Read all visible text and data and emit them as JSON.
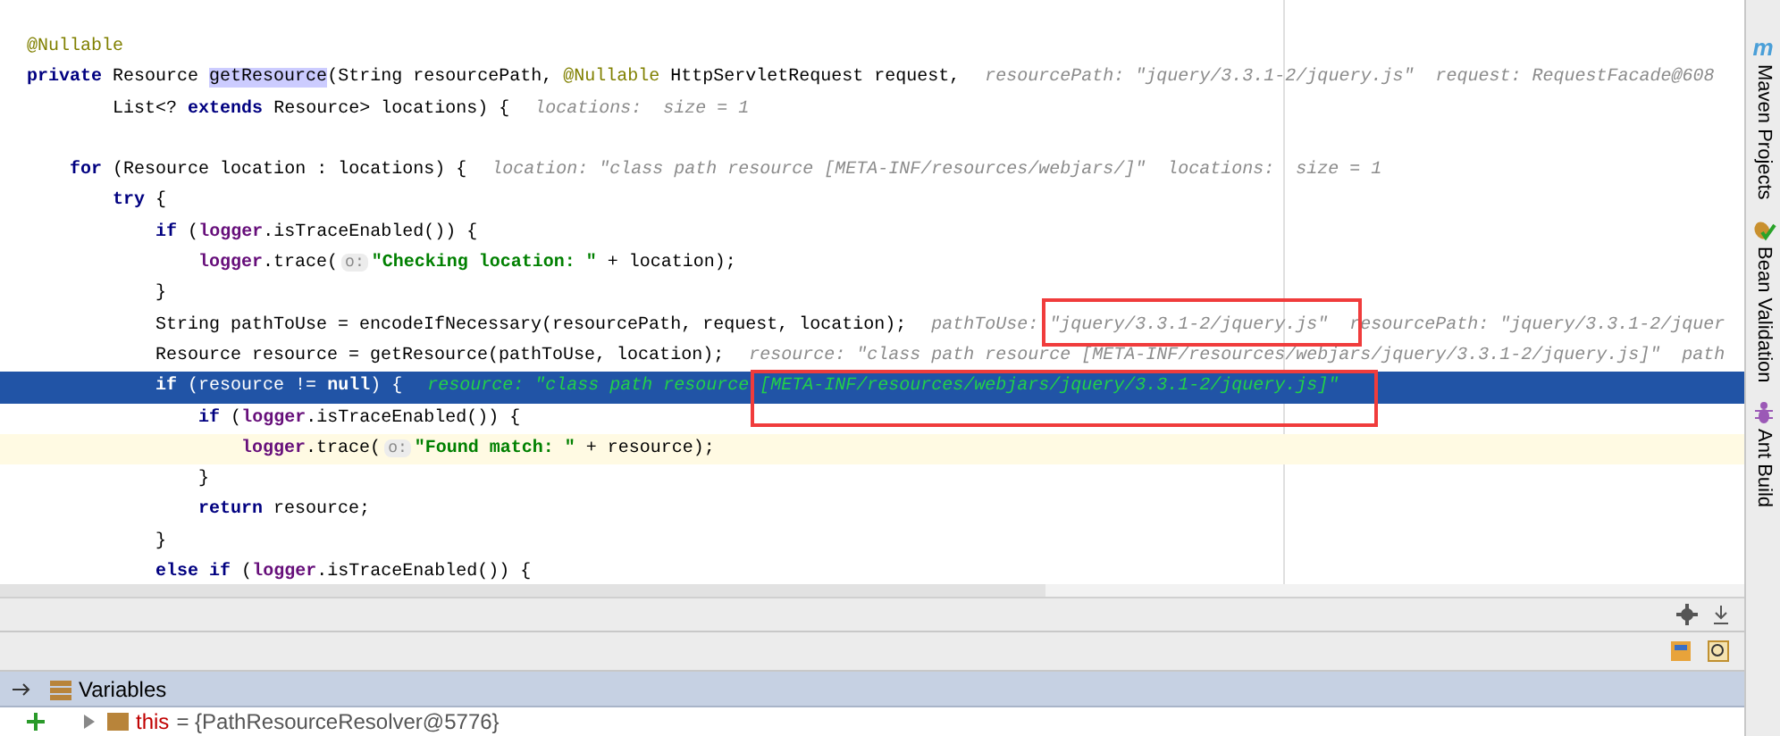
{
  "editor": {
    "lines": [
      {
        "selected": false,
        "caret": false,
        "segments": [
          {
            "kind": "ann",
            "text": "@Nullable"
          }
        ]
      },
      {
        "selected": false,
        "caret": false,
        "segments": [
          {
            "kind": "kw",
            "text": "private"
          },
          {
            "kind": "plain",
            "text": " Resource "
          },
          {
            "kind": "usage",
            "text": "getResource"
          },
          {
            "kind": "plain",
            "text": "(String resourcePath, "
          },
          {
            "kind": "ann",
            "text": "@Nullable"
          },
          {
            "kind": "plain",
            "text": " HttpServletRequest request,"
          },
          {
            "kind": "hint",
            "text": "resourcePath: \"jquery/3.3.1-2/jquery.js\"  request: RequestFacade@608"
          }
        ]
      },
      {
        "selected": false,
        "caret": false,
        "segments": [
          {
            "kind": "plain",
            "text": "        List<? "
          },
          {
            "kind": "kw",
            "text": "extends"
          },
          {
            "kind": "plain",
            "text": " Resource> locations) {"
          },
          {
            "kind": "hint",
            "text": "locations:  size = 1"
          }
        ]
      },
      {
        "selected": false,
        "caret": false
      },
      {
        "selected": false,
        "caret": false,
        "segments": [
          {
            "kind": "kw",
            "text": "    for"
          },
          {
            "kind": "plain",
            "text": " (Resource location : locations) {"
          },
          {
            "kind": "hint",
            "text": "location: \"class path resource [META-INF/resources/webjars/]\"  locations:  size = 1"
          }
        ]
      },
      {
        "selected": false,
        "caret": false,
        "segments": [
          {
            "kind": "kw",
            "text": "        try"
          },
          {
            "kind": "plain",
            "text": " {"
          }
        ]
      },
      {
        "selected": false,
        "caret": false,
        "segments": [
          {
            "kind": "kw",
            "text": "            if"
          },
          {
            "kind": "plain",
            "text": " ("
          },
          {
            "kind": "field",
            "text": "logger"
          },
          {
            "kind": "plain",
            "text": ".isTraceEnabled()) {"
          }
        ]
      },
      {
        "selected": false,
        "caret": false,
        "segments": [
          {
            "kind": "field",
            "text": "                logger"
          },
          {
            "kind": "plain",
            "text": ".trace("
          },
          {
            "kind": "param",
            "text": "o:"
          },
          {
            "kind": "str",
            "text": "\"Checking location: \""
          },
          {
            "kind": "plain",
            "text": " + location);"
          }
        ]
      },
      {
        "selected": false,
        "caret": false,
        "segments": [
          {
            "kind": "plain",
            "text": "            }"
          }
        ]
      },
      {
        "selected": false,
        "caret": false,
        "segments": [
          {
            "kind": "plain",
            "text": "            String pathToUse = encodeIfNecessary(resourcePath, request, location);"
          },
          {
            "kind": "hint",
            "text": "pathToUse: \"jquery/3.3.1-2/jquery.js\"  resourcePath: \"jquery/3.3.1-2/jquer"
          }
        ]
      },
      {
        "selected": false,
        "caret": false,
        "segments": [
          {
            "kind": "plain",
            "text": "            Resource resource = getResource(pathToUse, location);"
          },
          {
            "kind": "hint",
            "text": "resource: \"class path resource [META-INF/resources/webjars/jquery/3.3.1-2/jquery.js]\"  path"
          }
        ]
      },
      {
        "selected": true,
        "caret": false,
        "segments": [
          {
            "kind": "kw",
            "text": "            if"
          },
          {
            "kind": "plain",
            "text": " (resource != "
          },
          {
            "kind": "kw",
            "text": "null"
          },
          {
            "kind": "plain",
            "text": ") {"
          },
          {
            "kind": "hint",
            "text": "resource: \"class path resource [META-INF/resources/webjars/jquery/3.3.1-2/jquery.js]\""
          }
        ]
      },
      {
        "selected": false,
        "caret": false,
        "segments": [
          {
            "kind": "kw",
            "text": "                if"
          },
          {
            "kind": "plain",
            "text": " ("
          },
          {
            "kind": "field",
            "text": "logger"
          },
          {
            "kind": "plain",
            "text": ".isTraceEnabled()) {"
          }
        ]
      },
      {
        "selected": false,
        "caret": true,
        "segments": [
          {
            "kind": "field",
            "text": "                    logger"
          },
          {
            "kind": "plain",
            "text": ".trace("
          },
          {
            "kind": "param",
            "text": "o:"
          },
          {
            "kind": "str",
            "text": "\"Found match: \""
          },
          {
            "kind": "plain",
            "text": " + resource);"
          }
        ]
      },
      {
        "selected": false,
        "caret": false,
        "segments": [
          {
            "kind": "plain",
            "text": "                }"
          }
        ]
      },
      {
        "selected": false,
        "caret": false,
        "segments": [
          {
            "kind": "kw",
            "text": "                return"
          },
          {
            "kind": "plain",
            "text": " resource;"
          }
        ]
      },
      {
        "selected": false,
        "caret": false,
        "segments": [
          {
            "kind": "plain",
            "text": "            }"
          }
        ]
      },
      {
        "selected": false,
        "caret": false,
        "segments": [
          {
            "kind": "kw",
            "text": "            else if"
          },
          {
            "kind": "plain",
            "text": " ("
          },
          {
            "kind": "field",
            "text": "logger"
          },
          {
            "kind": "plain",
            "text": ".isTraceEnabled()) {"
          }
        ]
      }
    ]
  },
  "tool_windows": [
    {
      "label": "Maven Projects",
      "kind": "maven",
      "icon_text": "m"
    },
    {
      "label": "Bean Validation",
      "kind": "bean"
    },
    {
      "label": "Ant Build",
      "kind": "ant"
    }
  ],
  "debugger": {
    "variables_title": "Variables",
    "rows": [
      {
        "name": "this",
        "value": "= {PathResourceResolver@5776}"
      }
    ]
  }
}
